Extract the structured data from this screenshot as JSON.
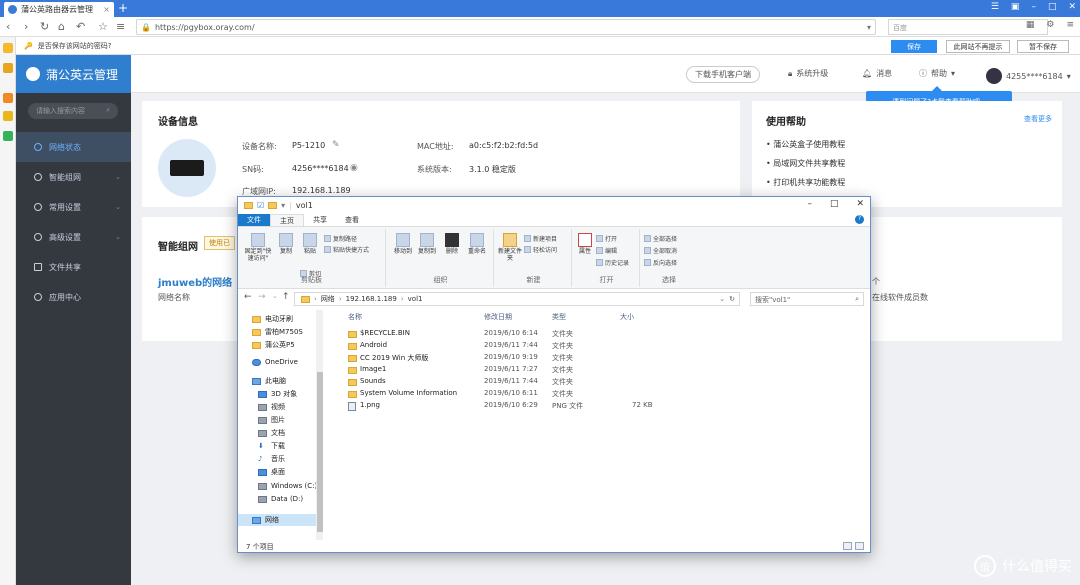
{
  "browser": {
    "tab_title": "蒲公英路由器云管理",
    "url": "https://pgybox.oray.com/",
    "search_placeholder": "百度",
    "save_prompt": "是否保存该网站的密码?",
    "save_button": "保存",
    "never_button": "此网站不再提示",
    "not_now_button": "暂不保存"
  },
  "header": {
    "brand": "蒲公英云管理",
    "download_client": "下载手机客户端",
    "system_upgrade": "系统升级",
    "messages": "消息",
    "help": "帮助",
    "account": "4255****6184"
  },
  "tooltip": "遇到问题了?点我查看帮助吧~",
  "sidebar": {
    "search_placeholder": "请输入搜索内容",
    "items": [
      {
        "label": "网络状态",
        "active": true
      },
      {
        "label": "智能组网"
      },
      {
        "label": "常用设置"
      },
      {
        "label": "高级设置"
      },
      {
        "label": "文件共享"
      },
      {
        "label": "应用中心"
      }
    ]
  },
  "device": {
    "title": "设备信息",
    "name_label": "设备名称:",
    "name_value": "P5-1210",
    "sn_label": "SN码:",
    "sn_value": "4256****6184",
    "wan_label": "广域网IP:",
    "wan_value": "192.168.1.189",
    "mac_label": "MAC地址:",
    "mac_value": "a0:c5:f2:b2:fd:5d",
    "version_label": "系统版本:",
    "version_value": "3.1.0 稳定版"
  },
  "helpcard": {
    "title": "使用帮助",
    "more": "查看更多",
    "items": [
      "蒲公英盒子使用教程",
      "局域网文件共享教程",
      "打印机共享功能教程"
    ]
  },
  "smartnet": {
    "title": "智能组网",
    "badge": "使用已",
    "network_name": "jmuweb的网络",
    "network_label": "网络名称",
    "right_text1": "个",
    "right_text2": "在线软件成员数"
  },
  "explorer": {
    "title": "vol1",
    "tabs": [
      "文件",
      "主页",
      "共享",
      "查看"
    ],
    "groups": [
      "剪贴板",
      "组织",
      "新建",
      "打开",
      "选择"
    ],
    "clipboard": {
      "pin": "固定到\"快速访问\"",
      "copy": "复制",
      "paste": "粘贴",
      "cut": "剪切",
      "copy_path": "复制路径",
      "paste_shortcut": "粘贴快捷方式"
    },
    "organize": {
      "move": "移动到",
      "copyto": "复制到",
      "delete": "删除",
      "rename": "重命名"
    },
    "new": {
      "folder": "新建文件夹",
      "item": "新建项目",
      "easy": "轻松访问"
    },
    "open": {
      "props": "属性",
      "open": "打开",
      "edit": "编辑",
      "history": "历史记录"
    },
    "select": {
      "all": "全部选择",
      "none": "全部取消",
      "invert": "反向选择"
    },
    "path": [
      "网络",
      "192.168.1.189",
      "vol1"
    ],
    "search_placeholder": "搜索\"vol1\"",
    "columns": [
      "名称",
      "修改日期",
      "类型",
      "大小"
    ],
    "nav": [
      {
        "label": "电动牙刷",
        "icon": "folder"
      },
      {
        "label": "雷柏M750S",
        "icon": "folder"
      },
      {
        "label": "蒲公英P5",
        "icon": "folder"
      },
      {
        "label": "OneDrive",
        "icon": "cloud"
      },
      {
        "label": "此电脑",
        "icon": "pc"
      },
      {
        "label": "3D 对象",
        "icon": "folder-blue"
      },
      {
        "label": "视频",
        "icon": "folder-gray"
      },
      {
        "label": "图片",
        "icon": "folder-gray"
      },
      {
        "label": "文档",
        "icon": "folder-gray"
      },
      {
        "label": "下载",
        "icon": "download"
      },
      {
        "label": "音乐",
        "icon": "music"
      },
      {
        "label": "桌面",
        "icon": "folder-blue"
      },
      {
        "label": "Windows (C:)",
        "icon": "drive"
      },
      {
        "label": "Data (D:)",
        "icon": "drive"
      },
      {
        "label": "网络",
        "icon": "network"
      }
    ],
    "files": [
      {
        "name": "$RECYCLE.BIN",
        "date": "2019/6/10 6:14",
        "type": "文件夹",
        "size": ""
      },
      {
        "name": "Android",
        "date": "2019/6/11 7:44",
        "type": "文件夹",
        "size": ""
      },
      {
        "name": "CC 2019 Win 大师版",
        "date": "2019/6/10 9:19",
        "type": "文件夹",
        "size": ""
      },
      {
        "name": "Image1",
        "date": "2019/6/11 7:27",
        "type": "文件夹",
        "size": ""
      },
      {
        "name": "Sounds",
        "date": "2019/6/11 7:44",
        "type": "文件夹",
        "size": ""
      },
      {
        "name": "System Volume Information",
        "date": "2019/6/10 6:11",
        "type": "文件夹",
        "size": ""
      },
      {
        "name": "1.png",
        "date": "2019/6/10 6:29",
        "type": "PNG 文件",
        "size": "72 KB"
      }
    ],
    "status": "7 个项目"
  },
  "watermark": {
    "circle": "值",
    "text": "什么值得买"
  }
}
